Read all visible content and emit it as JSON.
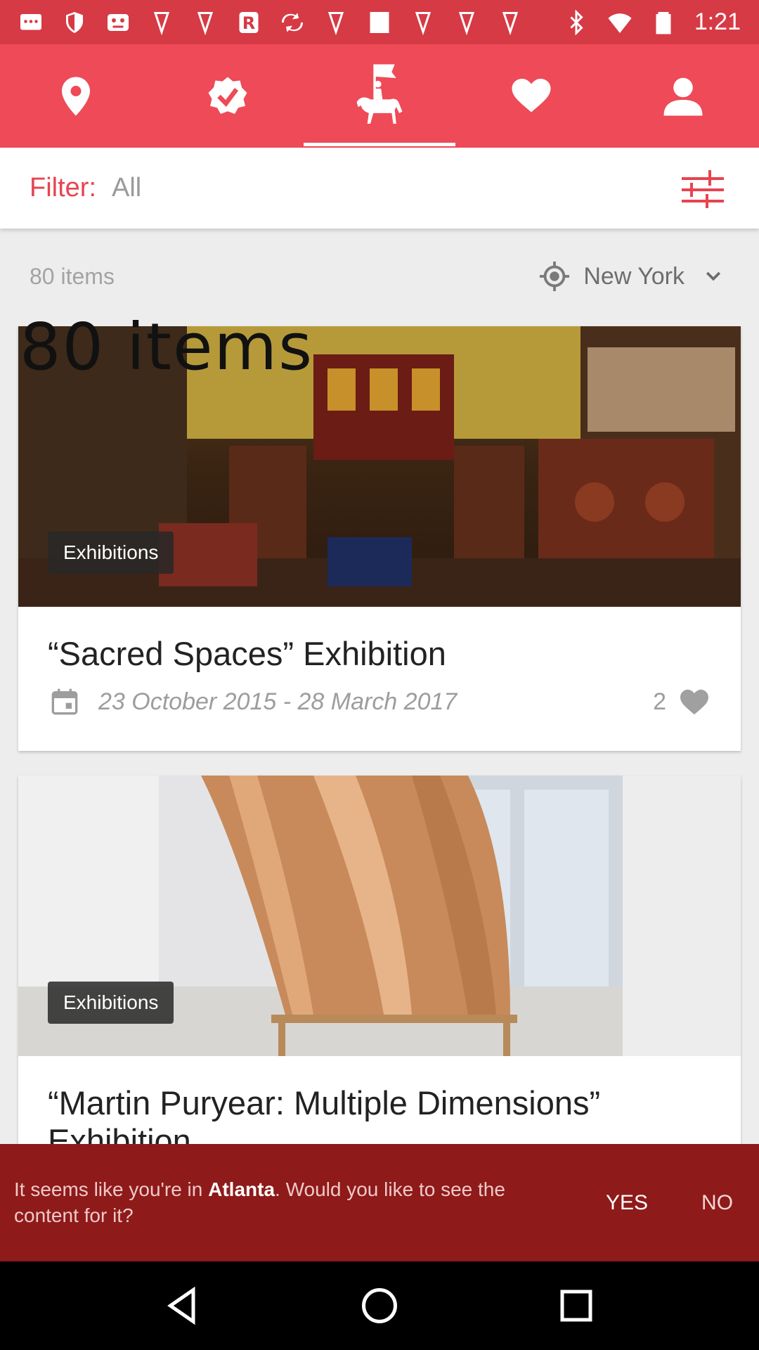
{
  "status_bar": {
    "time": "1:21",
    "left_icons": [
      "message-icon",
      "shield-icon",
      "game-icon",
      "location-pin-icon",
      "location-pin-icon",
      "r-app-icon",
      "spinner-icon",
      "location-pin-icon",
      "square-icon",
      "location-pin-icon",
      "location-pin-icon",
      "location-pin-icon"
    ],
    "right_icons": [
      "bluetooth-icon",
      "wifi-icon",
      "battery-icon"
    ]
  },
  "tabs": [
    {
      "name": "location-pin-icon",
      "active": false
    },
    {
      "name": "verified-badge-icon",
      "active": false
    },
    {
      "name": "horse-rider-logo-icon",
      "active": true
    },
    {
      "name": "heart-icon",
      "active": false
    },
    {
      "name": "person-icon",
      "active": false
    }
  ],
  "filter": {
    "label": "Filter:",
    "value": "All"
  },
  "meta": {
    "items_count": "80 items",
    "location": "New York"
  },
  "overlay_text": "80 items",
  "cards": [
    {
      "badge": "Exhibitions",
      "title": "“Sacred Spaces” Exhibition",
      "date": "23 October 2015 - 28 March 2017",
      "likes": "2"
    },
    {
      "badge": "Exhibitions",
      "title": "“Martin Puryear: Multiple Dimensions” Exhibition"
    }
  ],
  "prompt": {
    "text_before": "It seems like you're in ",
    "city": "Atlanta",
    "text_after": ". Would you like to see the content for it?",
    "yes": "YES",
    "no": "NO"
  },
  "colors": {
    "brand": "#ee4a57",
    "status_bar": "#d63a45",
    "prompt_bg": "#8e1a1a"
  }
}
